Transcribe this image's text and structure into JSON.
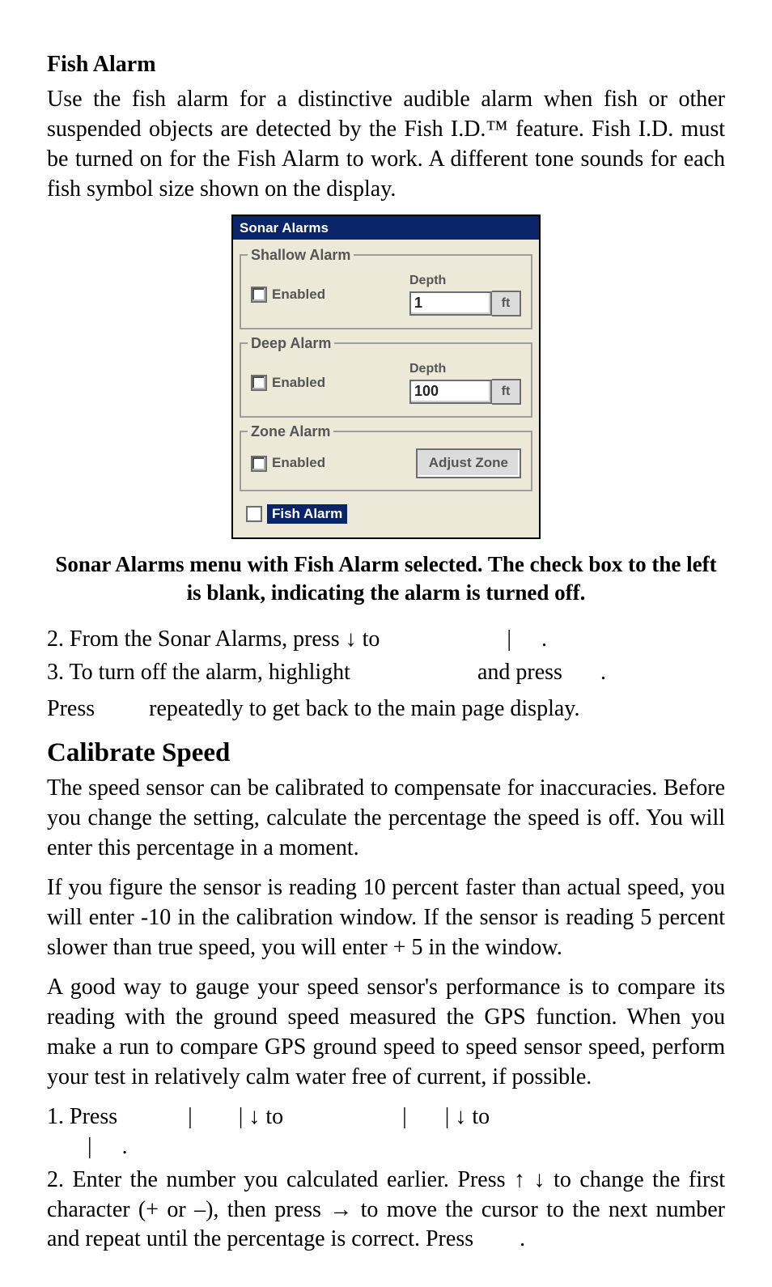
{
  "h_fish_alarm": "Fish Alarm",
  "p_fish_alarm": "Use the fish alarm for a distinctive audible alarm when fish or other suspended objects are detected by the Fish I.D.™ feature. Fish I.D. must be turned on for the Fish Alarm to work. A different tone sounds for each fish symbol size shown on the display.",
  "caption": "Sonar Alarms menu with Fish Alarm selected. The check box to the left is blank, indicating the alarm is turned off.",
  "step2a": "2. From the Sonar Alarms, press ",
  "step2_arrow": "↓",
  "step2b": " to ",
  "step2c": "|",
  "step2d": ".",
  "step3a": "3. To turn off the alarm, highlight ",
  "step3b": "and press ",
  "step3c": ".",
  "press_line_a": "Press ",
  "press_line_b": "repeatedly to get back to the main page display.",
  "h_calibrate": "Calibrate Speed",
  "p_cal1": "The speed sensor can be calibrated to compensate for inaccuracies. Before you change the setting, calculate the percentage the speed is off. You will enter this percentage in a moment.",
  "p_cal2": "If you figure the sensor is reading 10 percent faster than actual speed, you will enter -10 in the calibration window. If the sensor is reading 5 percent slower than true speed, you will enter + 5 in the window.",
  "p_cal3": "A good way to gauge your speed sensor's performance is to compare its reading with the ground speed measured the GPS function. When you make a run to compare GPS ground speed to speed sensor speed, perform your test in relatively calm water free of current, if possible.",
  "cal_step1_a": "1.  Press ",
  "cal_step1_b": "|",
  "cal_step1_c": "|",
  "cal_step1_d": "↓  to ",
  "cal_step1_e": "|",
  "cal_step1_f": "|",
  "cal_step1_g": "↓  to ",
  "cal_step1_h": "|",
  "cal_step1_i": ".",
  "cal_step2": "2. Enter the number you calculated earlier. Press ↑ ↓ to change the first character (+ or –), then press → to move the cursor to the next number and repeat until the percentage is correct. Press ",
  "cal_step2_end": ".",
  "ui": {
    "title": "Sonar Alarms",
    "shallow": {
      "legend": "Shallow Alarm",
      "enabled": "Enabled",
      "depth_label": "Depth",
      "depth_value": "1",
      "unit": "ft"
    },
    "deep": {
      "legend": "Deep Alarm",
      "enabled": "Enabled",
      "depth_label": "Depth",
      "depth_value": "100",
      "unit": "ft"
    },
    "zone": {
      "legend": "Zone Alarm",
      "enabled": "Enabled",
      "adjust": "Adjust Zone"
    },
    "fish": {
      "label": "Fish Alarm"
    }
  }
}
